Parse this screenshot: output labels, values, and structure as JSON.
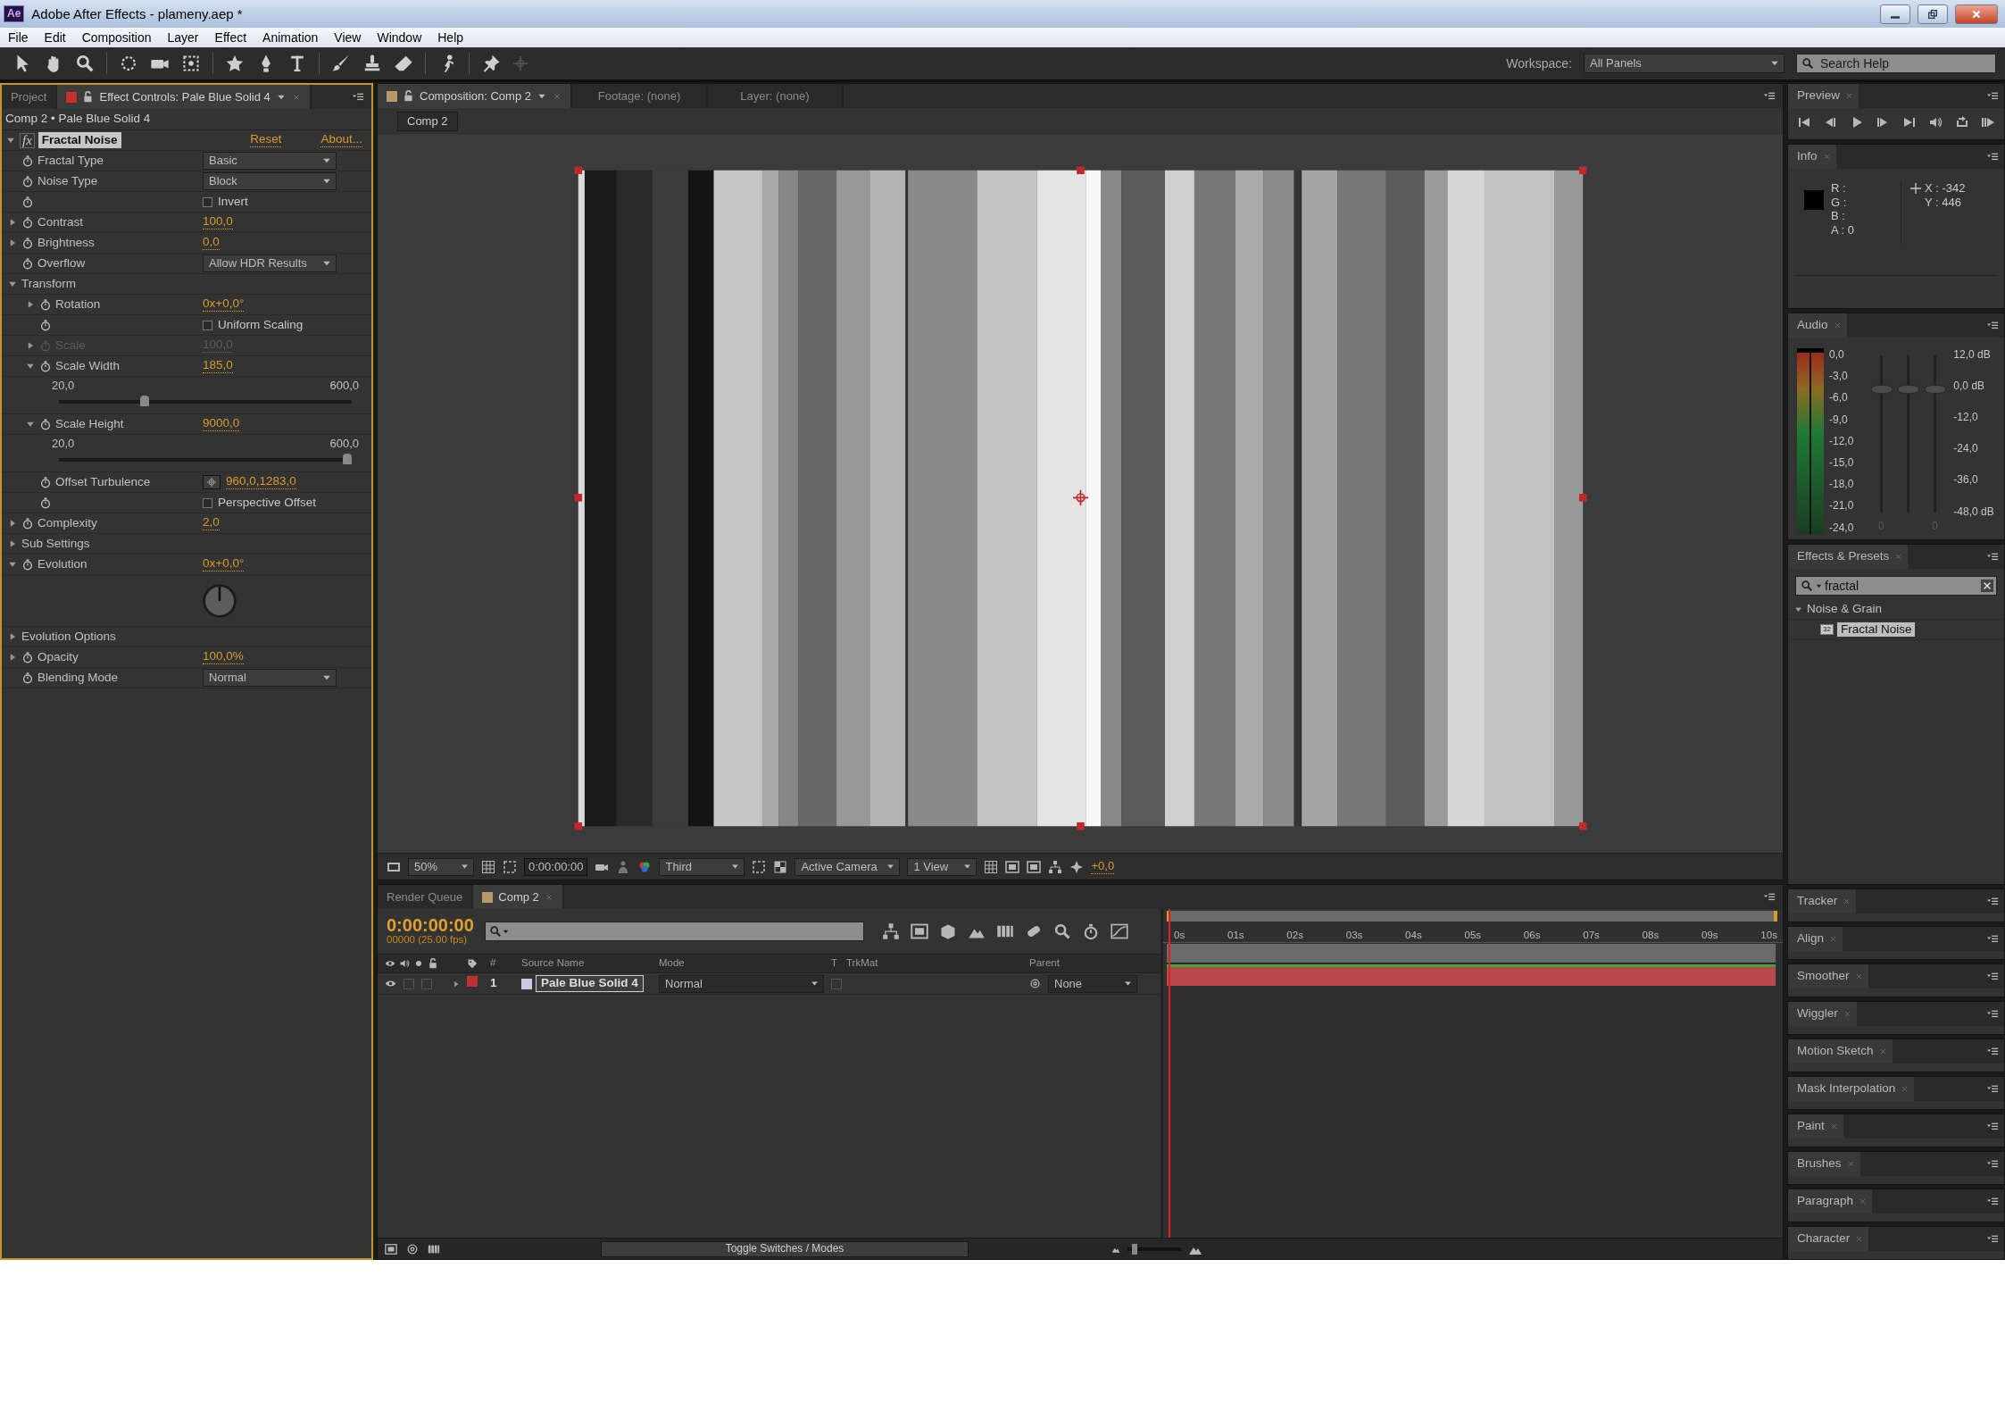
{
  "window": {
    "app_badge": "Ae",
    "title": "Adobe After Effects - plameny.aep *"
  },
  "menu": [
    "File",
    "Edit",
    "Composition",
    "Layer",
    "Effect",
    "Animation",
    "View",
    "Window",
    "Help"
  ],
  "workspace": {
    "label": "Workspace:",
    "value": "All Panels"
  },
  "help_search": {
    "placeholder": "Search Help"
  },
  "left_panel": {
    "tabs": [
      {
        "label": "Project",
        "selected": false
      },
      {
        "label": "Effect Controls: Pale Blue Solid 4",
        "selected": true
      }
    ],
    "breadcrumb": "Comp 2 • Pale Blue Solid 4",
    "effect": {
      "fx_label": "fx",
      "name": "Fractal Noise",
      "expanded": true,
      "reset": "Reset",
      "about": "About...",
      "properties": [
        {
          "kind": "dropdown",
          "label": "Fractal Type",
          "value": "Basic",
          "disabled": false
        },
        {
          "kind": "dropdown",
          "label": "Noise Type",
          "value": "Block",
          "disabled": false
        },
        {
          "kind": "checkbox",
          "label": "Invert",
          "checked": false,
          "disabled": false
        },
        {
          "kind": "value",
          "label": "Contrast",
          "value": "100,0",
          "expanded": false,
          "disabled": false
        },
        {
          "kind": "value",
          "label": "Brightness",
          "value": "0,0",
          "expanded": false,
          "disabled": false
        },
        {
          "kind": "dropdown",
          "label": "Overflow",
          "value": "Allow HDR Results",
          "disabled": false
        },
        {
          "kind": "group",
          "label": "Transform",
          "expanded": true,
          "disabled": false,
          "children": [
            {
              "kind": "value",
              "label": "Rotation",
              "value": "0x+0,0°",
              "expanded": false,
              "disabled": false
            },
            {
              "kind": "checkbox",
              "label": "Uniform Scaling",
              "checked": false,
              "disabled": false
            },
            {
              "kind": "value",
              "label": "Scale",
              "value": "100,0",
              "expanded": false,
              "disabled": true
            },
            {
              "kind": "value",
              "label": "Scale Width",
              "value": "185,0",
              "expanded": true,
              "disabled": false,
              "children": [
                {
                  "kind": "slider",
                  "min": "20,0",
                  "max": "600,0",
                  "level": 0.285
                }
              ]
            },
            {
              "kind": "value",
              "label": "Scale Height",
              "value": "9000,0",
              "expanded": true,
              "disabled": false,
              "children": [
                {
                  "kind": "slider",
                  "min": "20,0",
                  "max": "600,0",
                  "level": 1
                }
              ]
            },
            {
              "kind": "point",
              "label": "Offset Turbulence",
              "value": "960,0,1283,0",
              "disabled": false
            },
            {
              "kind": "checkbox",
              "label": "Perspective Offset",
              "checked": false,
              "disabled": false
            }
          ]
        },
        {
          "kind": "value",
          "label": "Complexity",
          "value": "2,0",
          "expanded": false,
          "disabled": false
        },
        {
          "kind": "group",
          "label": "Sub Settings",
          "expanded": false,
          "disabled": false
        },
        {
          "kind": "value",
          "label": "Evolution",
          "value": "0x+0,0°",
          "expanded": true,
          "disabled": false,
          "children": [
            {
              "kind": "dial"
            }
          ]
        },
        {
          "kind": "group",
          "label": "Evolution Options",
          "expanded": false,
          "disabled": false
        },
        {
          "kind": "value",
          "label": "Opacity",
          "value": "100,0%",
          "expanded": false,
          "disabled": false
        },
        {
          "kind": "dropdown",
          "label": "Blending Mode",
          "value": "Normal",
          "disabled": false
        }
      ]
    }
  },
  "composition_panel": {
    "tabs": [
      {
        "label": "Composition: Comp 2",
        "selected": true
      },
      {
        "label": "Footage: (none)",
        "selected": false
      },
      {
        "label": "Layer: (none)",
        "selected": false
      }
    ],
    "breadcrumb": "Comp 2",
    "view_bar": {
      "magnification": "50%",
      "timecode": "0:00:00:00",
      "resolution": "Third",
      "camera": "Active Camera",
      "layout": "1 View",
      "exposure": "+0,0"
    }
  },
  "timeline": {
    "tabs": [
      {
        "label": "Render Queue",
        "selected": false
      },
      {
        "label": "Comp 2",
        "selected": true
      }
    ],
    "timecode": "0:00:00:00",
    "frame_info": "00000 (25.00 fps)",
    "columns": [
      "#",
      "Source Name",
      "Mode",
      "T",
      "TrkMat",
      "Parent"
    ],
    "layers": [
      {
        "number": "1",
        "name": "Pale Blue Solid 4",
        "mode": "Normal",
        "parent": "None",
        "color": "#c03030",
        "selected": true
      }
    ],
    "ruler": [
      "0s",
      "01s",
      "02s",
      "03s",
      "04s",
      "05s",
      "06s",
      "07s",
      "08s",
      "09s",
      "10s"
    ],
    "toggle": "Toggle Switches / Modes",
    "zoom": {
      "level": 0.1
    }
  },
  "right_panels": {
    "preview": {
      "title": "Preview"
    },
    "info": {
      "title": "Info",
      "channels": [
        "R :",
        "G :",
        "B :",
        "A : 0"
      ],
      "x": "X : -342",
      "y": "Y : 446"
    },
    "audio": {
      "title": "Audio",
      "left_scale": [
        "0,0",
        "-3,0",
        "-6,0",
        "-9,0",
        "-12,0",
        "-15,0",
        "-18,0",
        "-21,0",
        "-24,0"
      ],
      "right_scale": [
        "12,0 dB",
        "0,0 dB",
        "-12,0",
        "-24,0",
        "-36,0",
        "-48,0 dB"
      ],
      "faders": [
        {
          "level": 0.8,
          "value": "0"
        },
        {
          "level": 0.8
        },
        {
          "level": 0.8,
          "value": "0"
        }
      ]
    },
    "effects_presets": {
      "title": "Effects & Presets",
      "search": "fractal",
      "tree": [
        {
          "label": "Noise & Grain",
          "expanded": true,
          "children": [
            {
              "label": "Fractal Noise",
              "badge": "32",
              "selected": true
            }
          ]
        }
      ]
    },
    "collapsed": [
      "Tracker",
      "Align",
      "Smoother",
      "Wiggler",
      "Motion Sketch",
      "Mask Interpolation",
      "Paint",
      "Brushes",
      "Paragraph",
      "Character"
    ]
  }
}
